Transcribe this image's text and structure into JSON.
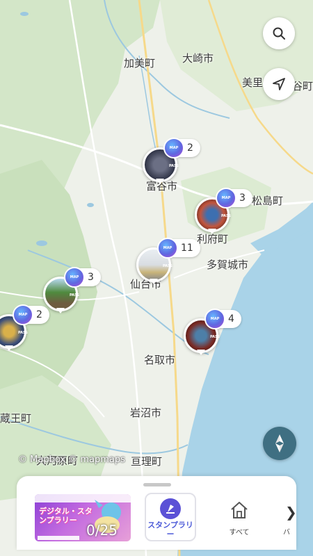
{
  "map": {
    "places": [
      {
        "id": "kami",
        "label": "加美町"
      },
      {
        "id": "osaki",
        "label": "大崎市"
      },
      {
        "id": "misato",
        "label": "美里"
      },
      {
        "id": "ishinomaki",
        "label": "谷町"
      },
      {
        "id": "tomiya",
        "label": "富谷市"
      },
      {
        "id": "matsushima",
        "label": "松島町"
      },
      {
        "id": "rifu",
        "label": "利府町"
      },
      {
        "id": "tagajo",
        "label": "多賀城市"
      },
      {
        "id": "sendai",
        "label": "仙台市"
      },
      {
        "id": "natori",
        "label": "名取市"
      },
      {
        "id": "iwanuma",
        "label": "岩沼市"
      },
      {
        "id": "zao",
        "label": "蔵王町"
      },
      {
        "id": "ogawara",
        "label": "大河原町"
      },
      {
        "id": "watari",
        "label": "亘理町"
      }
    ],
    "attribution": "© Mapbox © mapmaps"
  },
  "pins": [
    {
      "id": "tomiya",
      "count": "2",
      "badge": "MAP PASS"
    },
    {
      "id": "rifu",
      "count": "3",
      "badge": "MAP PASS"
    },
    {
      "id": "sendai",
      "count": "11",
      "badge": "MAP PASS"
    },
    {
      "id": "west",
      "count": "3",
      "badge": "MAP PASS"
    },
    {
      "id": "farwest",
      "count": "2",
      "badge": "MAP PASS"
    },
    {
      "id": "natori",
      "count": "4",
      "badge": "MAP PASS"
    }
  ],
  "controls": {
    "search_icon": "search-icon",
    "location_icon": "navigation-arrow-icon",
    "compass_icon": "compass-icon"
  },
  "panel": {
    "banner": {
      "title": "デジタル・スタンプラリー",
      "progress": "0/25"
    },
    "stamp_rally_label": "スタンプラリー",
    "all_label": "すべて",
    "next_partial_label": "バ"
  },
  "colors": {
    "accent": "#4d5bd8",
    "compass": "#3f6f82",
    "sea": "#a9d3e8"
  }
}
